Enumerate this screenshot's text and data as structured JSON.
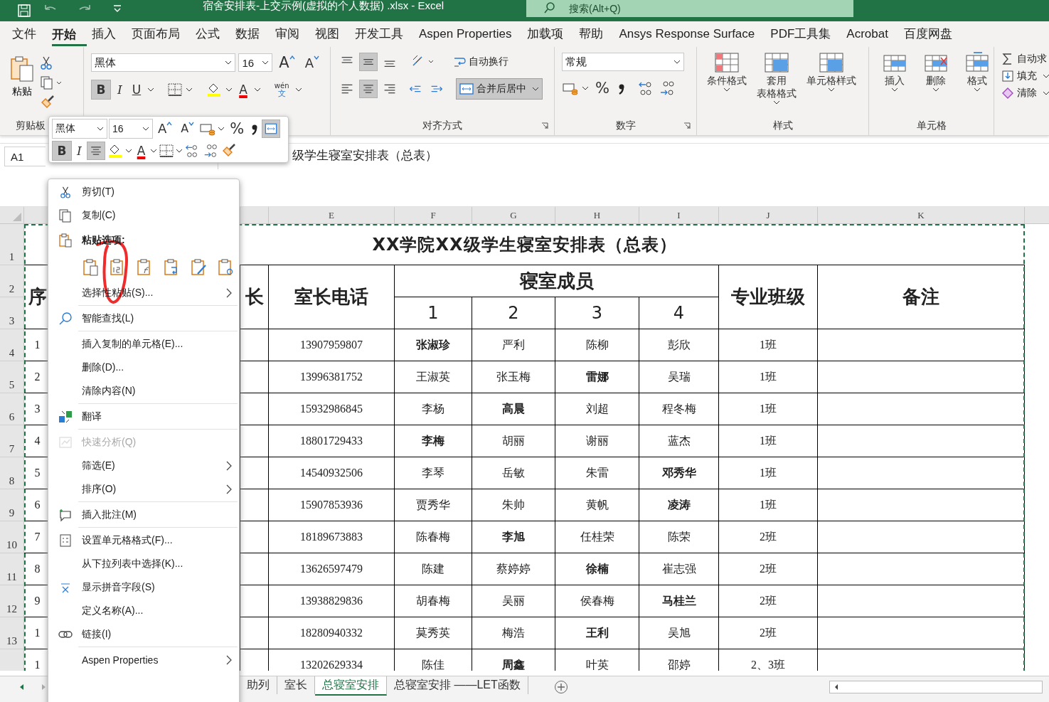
{
  "title_bar": {
    "title": "宿舍安排表-上交示例(虚拟的个人数据) .xlsx  -  Excel",
    "search_placeholder": "搜索(Alt+Q)"
  },
  "ribbon_tabs": [
    {
      "label": "文件",
      "selected": false
    },
    {
      "label": "开始",
      "selected": true
    },
    {
      "label": "插入",
      "selected": false
    },
    {
      "label": "页面布局",
      "selected": false
    },
    {
      "label": "公式",
      "selected": false
    },
    {
      "label": "数据",
      "selected": false
    },
    {
      "label": "审阅",
      "selected": false
    },
    {
      "label": "视图",
      "selected": false
    },
    {
      "label": "开发工具",
      "selected": false
    },
    {
      "label": "Aspen Properties",
      "selected": false
    },
    {
      "label": "加载项",
      "selected": false
    },
    {
      "label": "帮助",
      "selected": false
    },
    {
      "label": "Ansys Response Surface",
      "selected": false
    },
    {
      "label": "PDF工具集",
      "selected": false
    },
    {
      "label": "Acrobat",
      "selected": false
    },
    {
      "label": "百度网盘",
      "selected": false
    }
  ],
  "ribbon": {
    "clipboard": {
      "paste": "粘贴",
      "label": "剪贴板"
    },
    "font": {
      "name": "黑体",
      "size": "16",
      "grow": "A",
      "shrink": "A",
      "bold": "B",
      "italic": "I",
      "underline": "U",
      "color_letter": "A",
      "bold_on": true,
      "phonetic_top": "wén",
      "phonetic_bottom": "文"
    },
    "alignment": {
      "wrap": "自动换行",
      "merge": "合并后居中",
      "label": "对齐方式",
      "vertical_center_on": true,
      "center_on": true,
      "merge_on": true
    },
    "number": {
      "format": "常规",
      "percent": "%",
      "label": "数字"
    },
    "styles": {
      "buttons": [
        {
          "lines": [
            "条件格式"
          ]
        },
        {
          "lines": [
            "套用",
            "表格格式"
          ]
        },
        {
          "lines": [
            "单元格样式"
          ]
        }
      ],
      "label": "样式"
    },
    "cells": {
      "buttons": [
        "插入",
        "删除",
        "格式"
      ],
      "label": "单元格"
    },
    "editing": [
      "自动求",
      "填充",
      "清除"
    ]
  },
  "mini_toolbar": {
    "name": "黑体",
    "size": "16",
    "grow": "A",
    "shrink": "A",
    "percent": "%",
    "bold": "B",
    "italic": "I",
    "color_letter": "A",
    "bold_on": true,
    "center_on": true,
    "merge_on": true
  },
  "formula_bar": {
    "name_box": "A1",
    "content": "级学生寝室安排表（总表）"
  },
  "sheet": {
    "column_headers": [
      "E",
      "F",
      "G",
      "H",
      "I",
      "J",
      "K"
    ],
    "row_numbers": [
      "1",
      "2",
      "3",
      "4",
      "5",
      "6",
      "7",
      "8",
      "9",
      "10",
      "11",
      "12",
      "13"
    ],
    "title": "XX学院XX级学生寝室安排表（总表）",
    "header": {
      "serial": "序",
      "leader": "长",
      "phone": "室长电话",
      "members": "寝室成员",
      "member_numbers": [
        "1",
        "2",
        "3",
        "4"
      ],
      "class": "专业班级",
      "notes": "备注"
    },
    "rows": [
      {
        "serial": "1",
        "phone": "13907959807",
        "class": "1班",
        "members": [
          {
            "name": "张淑珍",
            "leader": true
          },
          {
            "name": "严利",
            "leader": false
          },
          {
            "name": "陈柳",
            "leader": false
          },
          {
            "name": "彭欣",
            "leader": false
          }
        ]
      },
      {
        "serial": "2",
        "phone": "13996381752",
        "class": "1班",
        "members": [
          {
            "name": "王淑英",
            "leader": false
          },
          {
            "name": "张玉梅",
            "leader": false
          },
          {
            "name": "雷娜",
            "leader": true
          },
          {
            "name": "吴瑞",
            "leader": false
          }
        ]
      },
      {
        "serial": "3",
        "phone": "15932986845",
        "class": "1班",
        "members": [
          {
            "name": "李杨",
            "leader": false
          },
          {
            "name": "高晨",
            "leader": true
          },
          {
            "name": "刘超",
            "leader": false
          },
          {
            "name": "程冬梅",
            "leader": false
          }
        ]
      },
      {
        "serial": "4",
        "phone": "18801729433",
        "class": "1班",
        "members": [
          {
            "name": "李梅",
            "leader": true
          },
          {
            "name": "胡丽",
            "leader": false
          },
          {
            "name": "谢丽",
            "leader": false
          },
          {
            "name": "蓝杰",
            "leader": false
          }
        ]
      },
      {
        "serial": "5",
        "phone": "14540932506",
        "class": "1班",
        "members": [
          {
            "name": "李琴",
            "leader": false
          },
          {
            "name": "岳敏",
            "leader": false
          },
          {
            "name": "朱雷",
            "leader": false
          },
          {
            "name": "邓秀华",
            "leader": true
          }
        ]
      },
      {
        "serial": "6",
        "phone": "15907853936",
        "class": "1班",
        "members": [
          {
            "name": "贾秀华",
            "leader": false
          },
          {
            "name": "朱帅",
            "leader": false
          },
          {
            "name": "黄帆",
            "leader": false
          },
          {
            "name": "凌涛",
            "leader": true
          }
        ]
      },
      {
        "serial": "7",
        "phone": "18189673883",
        "class": "2班",
        "members": [
          {
            "name": "陈春梅",
            "leader": false
          },
          {
            "name": "李旭",
            "leader": true
          },
          {
            "name": "任桂荣",
            "leader": false
          },
          {
            "name": "陈荣",
            "leader": false
          }
        ]
      },
      {
        "serial": "8",
        "phone": "13626597479",
        "class": "2班",
        "members": [
          {
            "name": "陈建",
            "leader": false
          },
          {
            "name": "蔡婷婷",
            "leader": false
          },
          {
            "name": "徐楠",
            "leader": true
          },
          {
            "name": "崔志强",
            "leader": false
          }
        ]
      },
      {
        "serial": "9",
        "phone": "13938829836",
        "class": "2班",
        "members": [
          {
            "name": "胡春梅",
            "leader": false
          },
          {
            "name": "吴丽",
            "leader": false
          },
          {
            "name": "侯春梅",
            "leader": false
          },
          {
            "name": "马桂兰",
            "leader": true
          }
        ]
      },
      {
        "serial": "1",
        "phone": "18280940332",
        "class": "2班",
        "members": [
          {
            "name": "莫秀英",
            "leader": false
          },
          {
            "name": "梅浩",
            "leader": false
          },
          {
            "name": "王利",
            "leader": true
          },
          {
            "name": "吴旭",
            "leader": false
          }
        ]
      },
      {
        "serial": "1",
        "phone": "13202629334",
        "class": "2、3班",
        "members": [
          {
            "name": "陈佳",
            "leader": false
          },
          {
            "name": "周鑫",
            "leader": true
          },
          {
            "name": "叶英",
            "leader": false
          },
          {
            "name": "邵婷",
            "leader": false
          }
        ]
      }
    ]
  },
  "context_menu": {
    "groups": [
      [
        {
          "label": "剪切(T)",
          "submenu": false,
          "disabled": false
        },
        {
          "label": "复制(C)",
          "submenu": false,
          "disabled": false
        },
        {
          "label": "粘贴选项:",
          "kind": "heading",
          "submenu": false,
          "disabled": false
        },
        {
          "kind": "paste_icons"
        },
        {
          "label": "选择性粘贴(S)...",
          "submenu": true,
          "disabled": false
        }
      ],
      [
        {
          "label": "智能查找(L)",
          "submenu": false,
          "disabled": false
        }
      ],
      [
        {
          "label": "插入复制的单元格(E)...",
          "submenu": false,
          "disabled": false
        },
        {
          "label": "删除(D)...",
          "submenu": false,
          "disabled": false
        },
        {
          "label": "清除内容(N)",
          "submenu": false,
          "disabled": false
        }
      ],
      [
        {
          "label": "翻译",
          "submenu": false,
          "disabled": false
        }
      ],
      [
        {
          "label": "快速分析(Q)",
          "submenu": false,
          "disabled": true
        },
        {
          "label": "筛选(E)",
          "submenu": true,
          "disabled": false
        },
        {
          "label": "排序(O)",
          "submenu": true,
          "disabled": false
        }
      ],
      [
        {
          "label": "插入批注(M)",
          "submenu": false,
          "disabled": false
        }
      ],
      [
        {
          "label": "设置单元格格式(F)...",
          "submenu": false,
          "disabled": false
        },
        {
          "label": "从下拉列表中选择(K)...",
          "submenu": false,
          "disabled": false
        },
        {
          "label": "显示拼音字段(S)",
          "submenu": false,
          "disabled": false
        },
        {
          "label": "定义名称(A)...",
          "submenu": false,
          "disabled": false
        },
        {
          "label": "链接(I)",
          "submenu": false,
          "disabled": false
        }
      ],
      [
        {
          "label": "Aspen Properties",
          "submenu": true,
          "disabled": false
        }
      ]
    ]
  },
  "sheet_tabs": [
    {
      "label": "助列",
      "selected": false
    },
    {
      "label": "室长",
      "selected": false
    },
    {
      "label": "总寝室安排",
      "selected": true
    },
    {
      "label": "总寝室安排 ——LET函数",
      "selected": false
    }
  ]
}
